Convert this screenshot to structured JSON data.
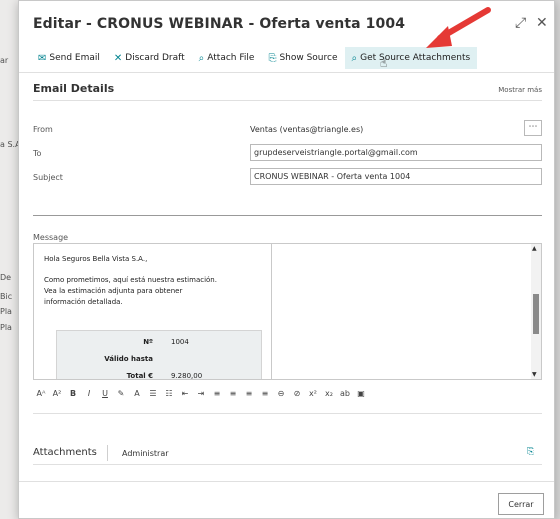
{
  "background": {
    "left_texts": [
      "ar",
      "a S.A",
      "De",
      "Bic",
      "Pla",
      "Pla"
    ]
  },
  "dialog": {
    "title": "Editar - CRONUS WEBINAR - Oferta venta 1004",
    "expand_icon": "expand-icon",
    "close_icon": "close-icon"
  },
  "toolbar": {
    "items": [
      {
        "label": "Send Email",
        "icon": "send-email-icon"
      },
      {
        "label": "Discard Draft",
        "icon": "discard-icon"
      },
      {
        "label": "Attach File",
        "icon": "paperclip-icon"
      },
      {
        "label": "Show Source",
        "icon": "show-source-icon"
      },
      {
        "label": "Get Source Attachments",
        "icon": "paperclip-icon"
      }
    ]
  },
  "email_details": {
    "title": "Email Details",
    "show_more": "Mostrar más",
    "from_label": "From",
    "from_value": "Ventas (ventas@triangle.es)",
    "to_label": "To",
    "to_value": "grupdeserveistriangle.portal@gmail.com",
    "subject_label": "Subject",
    "subject_value": "CRONUS WEBINAR - Oferta venta 1004",
    "message_label": "Message"
  },
  "message": {
    "greeting": "Hola Seguros Bella Vista S.A.,",
    "line1": "Como prometimos, aquí está nuestra estimación.",
    "line2": "Vea la estimación adjunta para obtener",
    "line3": "información detallada.",
    "table": [
      {
        "key": "Nº",
        "value": "1004"
      },
      {
        "key": "Válido hasta",
        "value": ""
      },
      {
        "key": "Total €",
        "value": "9.280,00"
      }
    ]
  },
  "format_toolbar": [
    "font-size-icon",
    "superscript-size-icon",
    "bold-icon",
    "italic-icon",
    "underline-icon",
    "highlight-icon",
    "font-color-icon",
    "bullets-icon",
    "numbering-icon",
    "indent-decrease-icon",
    "indent-increase-icon",
    "align-left-icon",
    "align-center-icon",
    "align-right-icon",
    "link-icon",
    "unlink-icon",
    "superscript-icon",
    "subscript-icon",
    "strikethrough-icon",
    "image-icon",
    "more-icon"
  ],
  "format_glyphs": [
    "Aᴬ",
    "A²",
    "B",
    "I",
    "U",
    "✎",
    "A",
    "☰",
    "☷",
    "⇤",
    "⇥",
    "≡",
    "≡",
    "≡",
    "≡",
    "⊖",
    "⊘",
    "x²",
    "x₂",
    "ab",
    "▣",
    "⋯"
  ],
  "attachments": {
    "label": "Attachments",
    "manage": "Administrar"
  },
  "footer": {
    "close_button": "Cerrar"
  },
  "colors": {
    "accent": "#00838f",
    "highlight": "#dff0f2",
    "arrow": "#e53935"
  }
}
